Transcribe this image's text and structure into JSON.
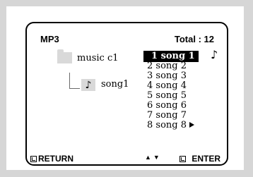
{
  "header": {
    "title": "MP3",
    "total_label": "Total : 12"
  },
  "tree": {
    "folder_icon": "folder-icon",
    "folder_label": "music c1",
    "file_icon": "music-note-icon",
    "file_label": "song1"
  },
  "songs": [
    "1 song 1",
    "2 song 2",
    "3 song 3",
    "4 song 4",
    "5 song 5",
    "6 song 6",
    "7 song 7",
    "8 song 8"
  ],
  "selected_index": 0,
  "icons": {
    "playing_note": "music-note-icon",
    "more_arrow": "play-arrow-icon",
    "return": "return-icon",
    "enter": "enter-icon",
    "nav": "up-down-arrows-icon"
  },
  "glyphs": {
    "note": "♪",
    "up": "▲",
    "down": "▼"
  },
  "footer": {
    "return_label": "RETURN",
    "enter_label": "ENTER"
  }
}
